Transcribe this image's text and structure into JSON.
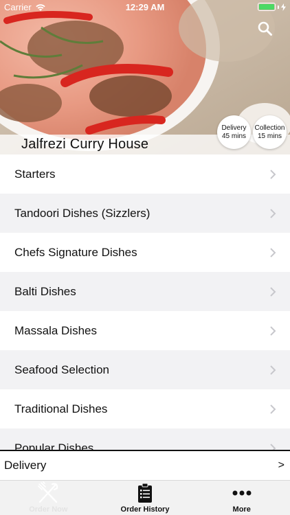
{
  "status_bar": {
    "carrier": "Carrier",
    "time": "12:29 AM"
  },
  "hero": {
    "restaurant_name": "Jalfrezi Curry House",
    "search_icon": "search-icon",
    "delivery_badge": {
      "title": "Delivery",
      "time": "45 mins"
    },
    "collection_badge": {
      "title": "Collection",
      "time": "15 mins"
    }
  },
  "menu": {
    "categories": [
      {
        "label": "Starters"
      },
      {
        "label": "Tandoori Dishes (Sizzlers)"
      },
      {
        "label": "Chefs Signature Dishes"
      },
      {
        "label": "Balti Dishes"
      },
      {
        "label": "Massala Dishes"
      },
      {
        "label": "Seafood Selection"
      },
      {
        "label": "Traditional Dishes"
      },
      {
        "label": "Popular Dishes"
      }
    ]
  },
  "delivery_bar": {
    "label": "Delivery",
    "arrow": ">"
  },
  "tab_bar": {
    "tabs": [
      {
        "label": "Order Now",
        "icon": "fork-knife-icon"
      },
      {
        "label": "Order History",
        "icon": "clipboard-icon"
      },
      {
        "label": "More",
        "icon": "more-dots-icon"
      }
    ]
  },
  "colors": {
    "battery": "#4cd964",
    "row_alt": "#f2f2f4",
    "tab_bar": "#f2f2f2"
  }
}
